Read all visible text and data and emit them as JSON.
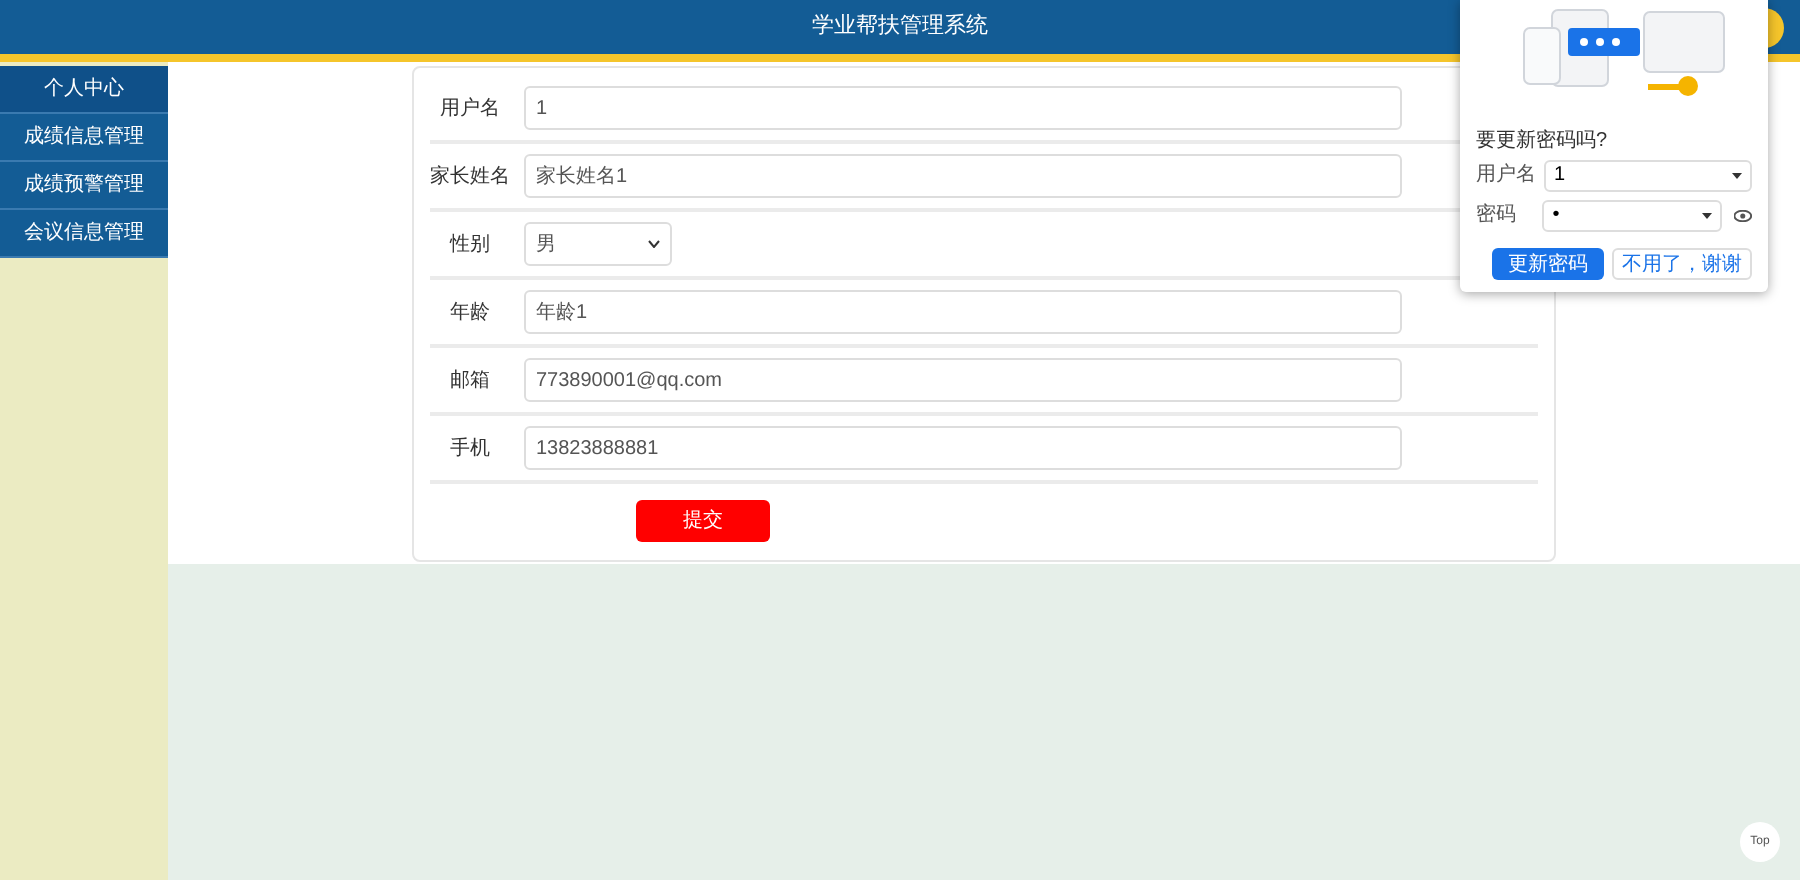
{
  "header": {
    "title": "学业帮扶管理系统"
  },
  "sidebar": {
    "items": [
      {
        "label": "个人中心",
        "selected": true
      },
      {
        "label": "成绩信息管理",
        "selected": false
      },
      {
        "label": "成绩预警管理",
        "selected": false
      },
      {
        "label": "会议信息管理",
        "selected": false
      }
    ]
  },
  "form": {
    "fields": [
      {
        "label": "用户名",
        "kind": "text",
        "value": "1"
      },
      {
        "label": "家长姓名",
        "kind": "text",
        "value": "家长姓名1"
      },
      {
        "label": "性别",
        "kind": "select",
        "value": "男"
      },
      {
        "label": "年龄",
        "kind": "text",
        "value": "年龄1"
      },
      {
        "label": "邮箱",
        "kind": "text",
        "value": "773890001@qq.com"
      },
      {
        "label": "手机",
        "kind": "text",
        "value": "13823888881"
      }
    ],
    "submit": "提交"
  },
  "password_popup": {
    "question": "要更新密码吗?",
    "username_label": "用户名",
    "username": "1",
    "password_label": "密码",
    "password": "•",
    "update_button": "更新密码",
    "dismiss_button": "不用了，谢谢"
  },
  "back_to_top": "Top"
}
